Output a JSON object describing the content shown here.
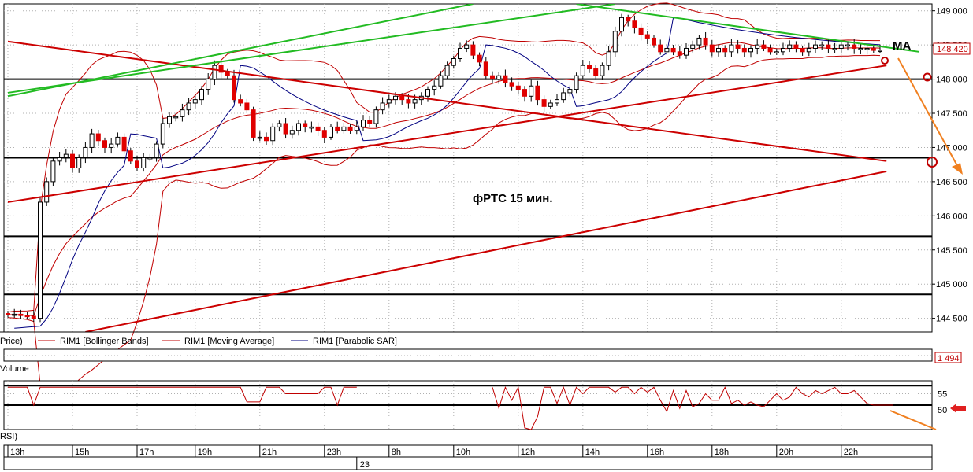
{
  "chart_data": [
    {
      "type": "candlestick",
      "title": "фРТС   15 мин.",
      "ylim": [
        144300,
        149100
      ],
      "y_ticks": [
        "149 000",
        "148 500",
        "148 000",
        "147 500",
        "147 000",
        "146 500",
        "146 000",
        "145 500",
        "145 000",
        "144 500"
      ],
      "y_tick_values": [
        149000,
        148500,
        148000,
        147500,
        147000,
        146500,
        146000,
        145500,
        145000,
        144500
      ],
      "current_price": "148 420",
      "current_price_value": 148420,
      "bar_count": 136,
      "closes": [
        144550,
        144560,
        144540,
        144530,
        144500,
        146200,
        146500,
        146800,
        146850,
        146900,
        146700,
        146850,
        147000,
        147200,
        147100,
        147000,
        147050,
        147150,
        146950,
        146800,
        146700,
        146850,
        146850,
        147050,
        147350,
        147450,
        147450,
        147550,
        147650,
        147700,
        147850,
        148000,
        148200,
        148100,
        148050,
        147700,
        147650,
        147550,
        147150,
        147150,
        147100,
        147300,
        147350,
        147200,
        147250,
        147350,
        147300,
        147300,
        147250,
        147150,
        147300,
        147250,
        147300,
        147250,
        147300,
        147400,
        147350,
        147550,
        147650,
        147700,
        147750,
        147700,
        147650,
        147700,
        147750,
        147850,
        147900,
        148050,
        148200,
        148300,
        148450,
        148500,
        148350,
        148250,
        148050,
        148000,
        148050,
        147950,
        147900,
        147850,
        147750,
        147900,
        147700,
        147600,
        147650,
        147700,
        147800,
        147850,
        148050,
        148200,
        148150,
        148050,
        148200,
        148400,
        148700,
        148900,
        148850,
        148750,
        148650,
        148600,
        148500,
        148400,
        148450,
        148400,
        148350,
        148450,
        148500,
        148600,
        148500,
        148400,
        148450,
        148400,
        148500,
        148450,
        148400,
        148450,
        148500,
        148450,
        148400,
        148400,
        148450,
        148500,
        148450,
        148400,
        148450,
        148500,
        148500,
        148450,
        148450,
        148500,
        148500,
        148450,
        148450,
        148450,
        148420,
        148420
      ],
      "series": [
        {
          "name": "RIM1 [Bollinger Bands]",
          "color": "#c00000"
        },
        {
          "name": "RIM1 [Moving Average]",
          "color": "#c00000"
        },
        {
          "name": "RIM1 [Parabolic SAR]",
          "color": "#000080"
        }
      ],
      "horizontal_levels": [
        148000,
        146850,
        145700,
        144850
      ],
      "trendlines": [
        {
          "color": "#cc0000",
          "from": [
            0,
            148550
          ],
          "to": [
            136,
            146800
          ]
        },
        {
          "color": "#cc0000",
          "from": [
            0,
            146200
          ],
          "to": [
            136,
            148200
          ]
        },
        {
          "color": "#cc0000",
          "from": [
            12,
            144300
          ],
          "to": [
            136,
            146650
          ]
        },
        {
          "color": "#22bb22",
          "from": [
            0,
            147750
          ],
          "to": [
            72,
            149100
          ]
        },
        {
          "color": "#22bb22",
          "from": [
            0,
            147800
          ],
          "to": [
            94,
            149100
          ]
        },
        {
          "color": "#22bb22",
          "from": [
            88,
            149100
          ],
          "to": [
            141,
            148400
          ]
        }
      ],
      "annotations": [
        {
          "text": "фРТС   15 мин."
        },
        {
          "text": "MA"
        }
      ]
    },
    {
      "type": "bar",
      "label": "Volume",
      "current_value": "1 494"
    },
    {
      "type": "line",
      "label": "RSI",
      "ylim": [
        44,
        59
      ],
      "y_ticks": [
        "55",
        "50"
      ],
      "y_tick_values": [
        55,
        50
      ],
      "guide_levels": [
        57.5,
        55,
        51.5
      ],
      "values": [
        57,
        57,
        57,
        57,
        51.5,
        57,
        57,
        57,
        57,
        57,
        57,
        57,
        57,
        57,
        57,
        57,
        57,
        57,
        57,
        57,
        57,
        57,
        57,
        57,
        57,
        57,
        57,
        57,
        57,
        57,
        57,
        57,
        57,
        57,
        57,
        57,
        57,
        52.5,
        52.5,
        52.5,
        57,
        57,
        57,
        55,
        55,
        55,
        55,
        55,
        55,
        57,
        57,
        51.5,
        57,
        57,
        57,
        null,
        null,
        null,
        null,
        null,
        null,
        null,
        null,
        null,
        null,
        null,
        null,
        null,
        null,
        null,
        null,
        null,
        null,
        null,
        null,
        57,
        50.5,
        57,
        53,
        57,
        44.5,
        44,
        48,
        57,
        57,
        52,
        57,
        51.5,
        57,
        55,
        57,
        57,
        57,
        57,
        55.5,
        57,
        57,
        55,
        57,
        55.5,
        57,
        53,
        49.5,
        56,
        50.5,
        56,
        51,
        52,
        55,
        53,
        53,
        57,
        52,
        53,
        51.5,
        52.5,
        51.5,
        51,
        53,
        55,
        53,
        54,
        57,
        55,
        54,
        56,
        55,
        56,
        57,
        55,
        55,
        56,
        54,
        52,
        51.5,
        51.5,
        51.5,
        51.5
      ]
    }
  ],
  "legend": {
    "price_label": "Price)",
    "items": [
      {
        "label": "RIM1 [Bollinger Bands]",
        "color": "#c00000"
      },
      {
        "label": "RIM1 [Moving Average]",
        "color": "#c00000"
      },
      {
        "label": "RIM1 [Parabolic SAR]",
        "color": "#000080"
      }
    ]
  },
  "volume_panel": {
    "label": "Volume",
    "value": "1 494"
  },
  "rsi_panel": {
    "label": "RSI)"
  },
  "time_axis": {
    "hour_labels": [
      "13h",
      "15h",
      "17h",
      "19h",
      "21h",
      "23h",
      "8h",
      "10h",
      "12h",
      "14h",
      "16h",
      "18h",
      "20h",
      "22h"
    ],
    "hour_bar_index": [
      0,
      10,
      20,
      29,
      39,
      49,
      59,
      69,
      79,
      89,
      99,
      109,
      119,
      129
    ],
    "day_label": "23",
    "day_bar_index": 54
  },
  "colors": {
    "candle_up": "#ffffff",
    "candle_down": "#e00000",
    "bollinger": "#c00000",
    "sar": "#000080",
    "trend_red": "#cc0000",
    "trend_green": "#22bb22",
    "orange_arrow": "#f08020",
    "grid": "#b0b0b0"
  }
}
